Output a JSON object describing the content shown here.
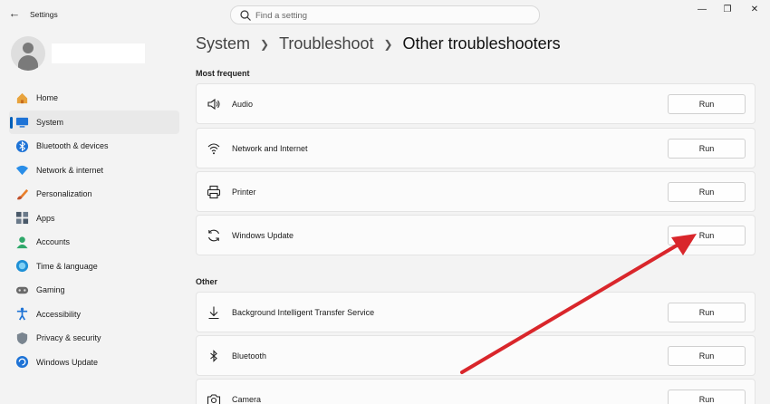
{
  "window": {
    "app_title": "Settings"
  },
  "search": {
    "placeholder": "Find a setting"
  },
  "nav": {
    "items": [
      {
        "label": "Home",
        "icon": "home-icon"
      },
      {
        "label": "System",
        "icon": "system-icon",
        "active": true
      },
      {
        "label": "Bluetooth & devices",
        "icon": "bluetooth-devices-icon"
      },
      {
        "label": "Network & internet",
        "icon": "network-icon"
      },
      {
        "label": "Personalization",
        "icon": "personalization-icon"
      },
      {
        "label": "Apps",
        "icon": "apps-icon"
      },
      {
        "label": "Accounts",
        "icon": "accounts-icon"
      },
      {
        "label": "Time & language",
        "icon": "time-language-icon"
      },
      {
        "label": "Gaming",
        "icon": "gaming-icon"
      },
      {
        "label": "Accessibility",
        "icon": "accessibility-icon"
      },
      {
        "label": "Privacy & security",
        "icon": "privacy-icon"
      },
      {
        "label": "Windows Update",
        "icon": "windows-update-icon"
      }
    ]
  },
  "breadcrumb": {
    "part1": "System",
    "part2": "Troubleshoot",
    "part3": "Other troubleshooters"
  },
  "sections": {
    "most_frequent": {
      "title": "Most frequent",
      "items": [
        {
          "label": "Audio",
          "icon": "speaker-icon",
          "button": "Run"
        },
        {
          "label": "Network and Internet",
          "icon": "wifi-icon",
          "button": "Run"
        },
        {
          "label": "Printer",
          "icon": "printer-icon",
          "button": "Run"
        },
        {
          "label": "Windows Update",
          "icon": "sync-icon",
          "button": "Run"
        }
      ]
    },
    "other": {
      "title": "Other",
      "items": [
        {
          "label": "Background Intelligent Transfer Service",
          "icon": "download-icon",
          "button": "Run"
        },
        {
          "label": "Bluetooth",
          "icon": "bluetooth-icon",
          "button": "Run"
        },
        {
          "label": "Camera",
          "icon": "camera-icon",
          "button": "Run"
        }
      ]
    }
  },
  "annotation": {
    "arrow_color": "#d9262b"
  },
  "colors": {
    "accent": "#005fb8"
  }
}
